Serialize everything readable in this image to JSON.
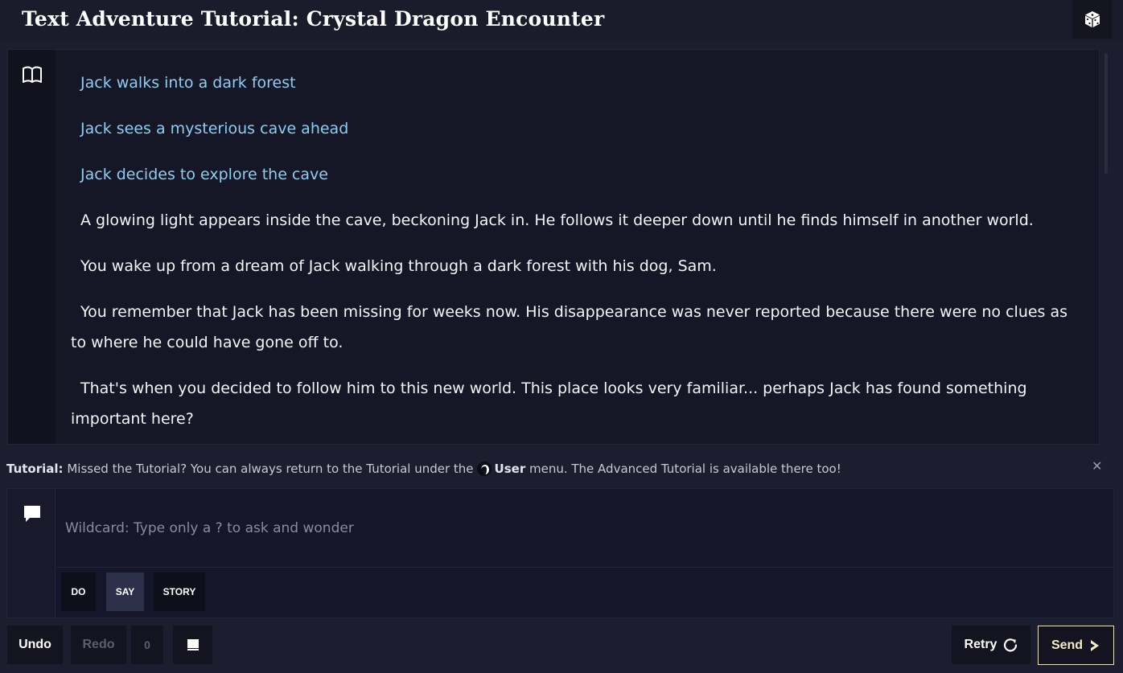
{
  "header": {
    "title": "Text Adventure Tutorial: Crystal Dragon Encounter",
    "dice_icon": "dice-icon"
  },
  "story": {
    "gutter_icon": "book-icon",
    "paragraphs": [
      {
        "type": "action",
        "text": "Jack walks into a dark forest"
      },
      {
        "type": "action",
        "text": "Jack sees a mysterious cave ahead"
      },
      {
        "type": "action",
        "text": "Jack decides to explore the cave"
      },
      {
        "type": "story",
        "text": "A glowing light appears inside the cave, beckoning Jack in. He follows it deeper down until he finds himself in another world."
      },
      {
        "type": "story",
        "text": "You wake up from a dream of Jack walking through a dark forest with his dog, Sam."
      },
      {
        "type": "story",
        "text": "You remember that Jack has been missing for weeks now. His disappearance was never reported because there were no clues as to where he could have gone off to."
      },
      {
        "type": "story",
        "text": "That's when you decided to follow him to this new world. This place looks very familiar... perhaps Jack has found something important here?"
      }
    ]
  },
  "tutorial": {
    "label": "Tutorial:",
    "text_before": "Missed the Tutorial? You can always return to the Tutorial under the",
    "user_label": "User",
    "text_after": "menu. The Advanced Tutorial is available there too!",
    "close": "✕"
  },
  "input": {
    "placeholder": "Wildcard: Type only a ? to ask and wonder",
    "value": "",
    "icon": "speech-bubble-icon",
    "modes": [
      {
        "label": "DO",
        "active": false
      },
      {
        "label": "SAY",
        "active": true
      },
      {
        "label": "STORY",
        "active": false
      }
    ]
  },
  "controls": {
    "undo": "Undo",
    "redo": "Redo",
    "count": "0",
    "retry": "Retry",
    "send": "Send"
  },
  "colors": {
    "background": "#1c1d2e",
    "action_text": "#8ecdf0",
    "send_accent": "#f2ecc9"
  }
}
